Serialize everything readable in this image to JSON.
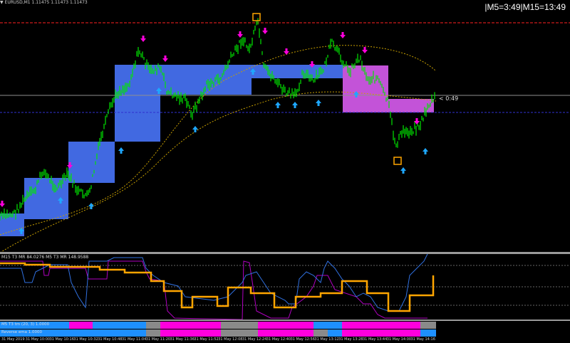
{
  "header": {
    "symbol_info": "▼ EURUSD,M1  1.11475 1.11473 1.11473",
    "timer": "|M5=3:49|M15=13:49"
  },
  "price_label": "< 0:49",
  "indicator": {
    "label": "M15 T3 MR  84.0276  M5 T3 MR  148.9588"
  },
  "bars": {
    "row1_label": "M5 T3 tm (20, 3) 1.0000",
    "row2_label": "Reverse ema 1.0000"
  },
  "time_axis": {
    "labels": [
      "31 May 2019",
      "31 May 10:00",
      "31 May 10:16",
      "31 May 10:32",
      "31 May 10:48",
      "31 May 11:04",
      "31 May 11:20",
      "31 May 11:36",
      "31 May 11:52",
      "31 May 12:08",
      "31 May 12:24",
      "31 May 12:40",
      "31 May 12:56",
      "31 May 13:12",
      "31 May 13:28",
      "31 May 13:44",
      "31 May 14:00",
      "31 May 14:16"
    ]
  },
  "colors": {
    "candle": "#00e600",
    "blue_box": "#4169e1",
    "violet_box": "#c353d8",
    "arrow_up": "#1ea7ff",
    "arrow_down": "#ff00dd",
    "orange_line": "#ffa500",
    "resistance": "#ff2020",
    "bid_line": "#909090",
    "ask_line": "#2020c0"
  }
}
